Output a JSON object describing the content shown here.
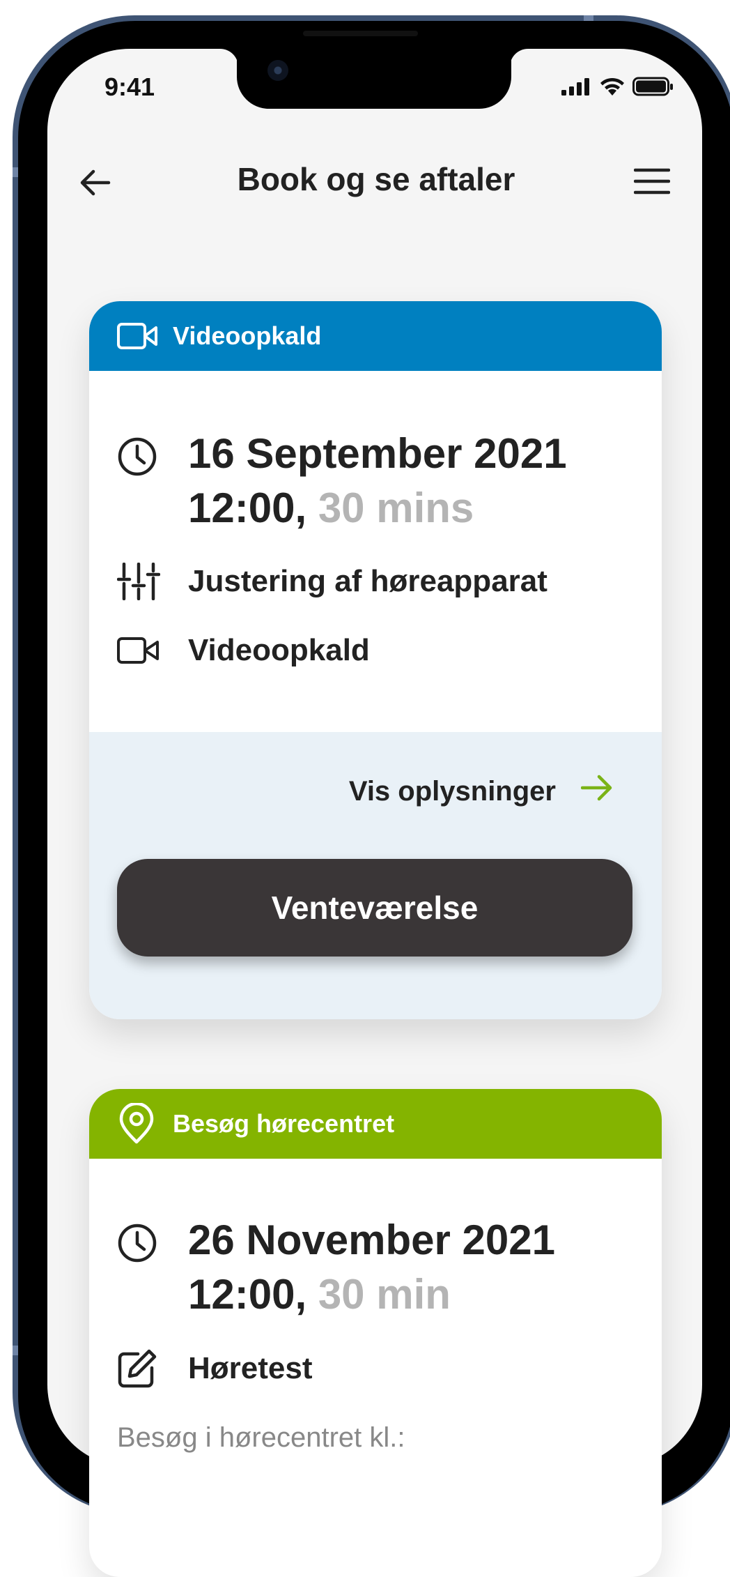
{
  "status_bar": {
    "time": "9:41"
  },
  "header": {
    "title": "Book og se aftaler"
  },
  "appointments": [
    {
      "type_label": "Videoopkald",
      "type_color": "#0080c0",
      "date": "16 September 2021",
      "time": "12:00,",
      "duration": "30 mins",
      "service": "Justering af høreapparat",
      "method": "Videoopkald",
      "details_link": "Vis oplysninger",
      "action_button": "Venteværelse"
    },
    {
      "type_label": "Besøg hørecentret",
      "type_color": "#84b400",
      "date": "26 November 2021",
      "time": "12:00,",
      "duration": "30 min",
      "service": "Høretest",
      "note": "Besøg i hørecentret kl.:"
    }
  ],
  "colors": {
    "accent_green": "#7ab317",
    "button_dark": "#3a3637"
  }
}
